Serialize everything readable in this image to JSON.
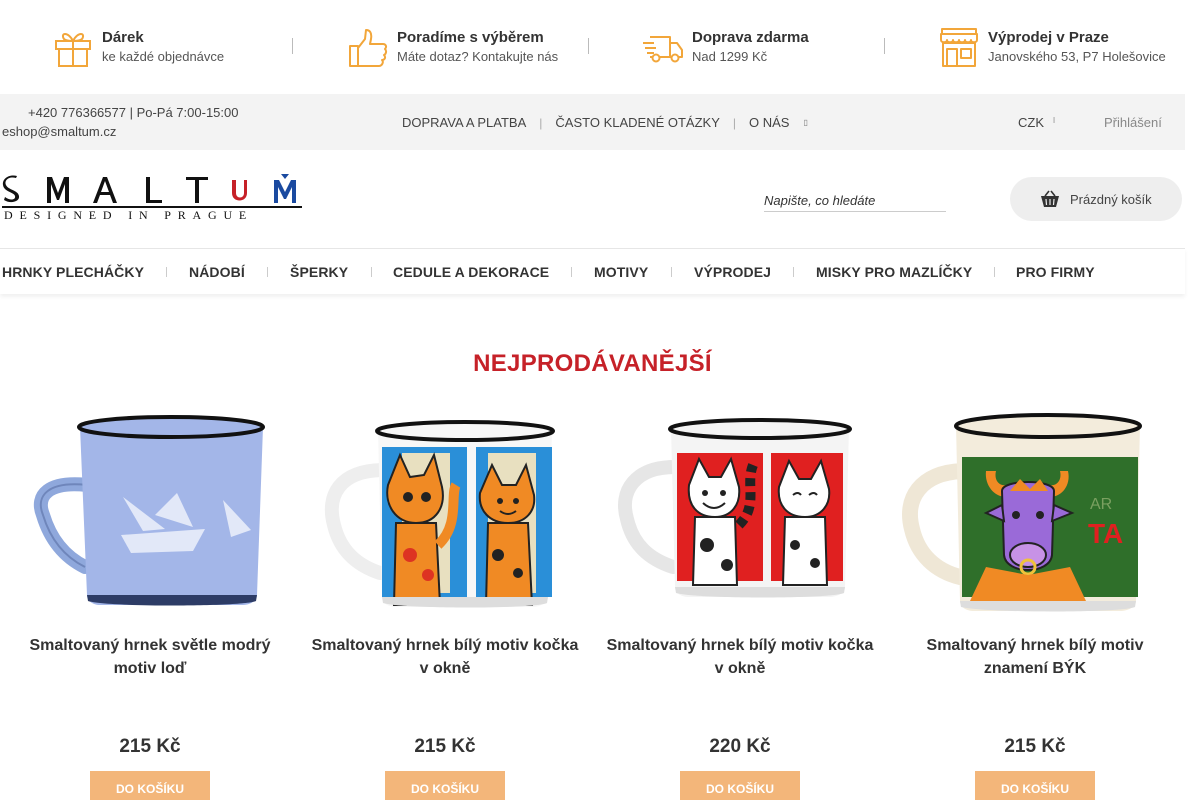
{
  "usp": [
    {
      "icon": "gift-icon",
      "title": "Dárek",
      "subtitle": "ke každé objednávce"
    },
    {
      "icon": "thumbs-up-icon",
      "title": "Poradíme s výběrem",
      "subtitle": "Máte dotaz? Kontakujte nás"
    },
    {
      "icon": "delivery-truck-icon",
      "title": "Doprava zdarma",
      "subtitle": "Nad 1299 Kč"
    },
    {
      "icon": "shop-icon",
      "title": "Výprodej v Praze",
      "subtitle": "Janovského 53, P7 Holešovice"
    }
  ],
  "topbar": {
    "phone": "+420 776366577 | Po-Pá 7:00-15:00",
    "email": "eshop@smaltum.cz",
    "nav": [
      "DOPRAVA A PLATBA",
      "ČASTO KLADENÉ OTÁZKY",
      "O NÁS"
    ],
    "currency": "CZK",
    "login": "Přihlášení"
  },
  "header": {
    "logo_main": "SMALTUM",
    "logo_sub": "DESIGNED IN PRAGUE",
    "search_placeholder": "Napište, co hledáte",
    "cart_label": "Prázdný košík"
  },
  "main_nav": [
    "HRNKY PLECHÁČKY",
    "NÁDOBÍ",
    "ŠPERKY",
    "CEDULE A DEKORACE",
    "MOTIVY",
    "VÝPRODEJ",
    "MISKY PRO MAZLÍČKY",
    "PRO FIRMY"
  ],
  "bestsellers": {
    "title": "NEJPRODÁVANĚJŠÍ",
    "products": [
      {
        "name": "Smaltovaný hrnek světle modrý motiv loď",
        "price": "215 Kč",
        "button": "DO KOŠÍKU"
      },
      {
        "name": "Smaltovaný hrnek bílý motiv kočka v okně",
        "price": "215 Kč",
        "button": "DO KOŠÍKU"
      },
      {
        "name": "Smaltovaný hrnek bílý motiv kočka v okně",
        "price": "220 Kč",
        "button": "DO KOŠÍKU"
      },
      {
        "name": "Smaltovaný hrnek bílý motiv znamení BÝK",
        "price": "215 Kč",
        "button": "DO KOŠÍKU"
      }
    ]
  },
  "colors": {
    "accent_red": "#c62128",
    "button_orange": "#f3b67a",
    "icon_orange": "#f2a63a"
  }
}
